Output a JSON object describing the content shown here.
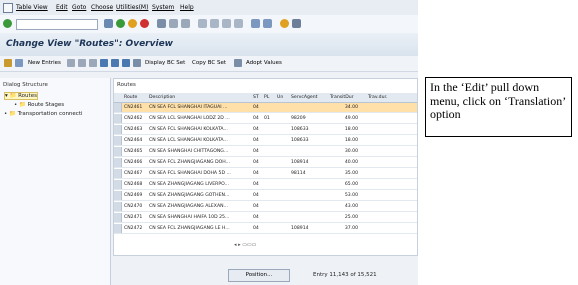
{
  "menu": [
    "Table View",
    "Edit",
    "Goto",
    "Choose",
    "Utilities(M)",
    "System",
    "Help"
  ],
  "title": "Change View \"Routes\": Overview",
  "app_toolbar": {
    "new_entries": "New Entries",
    "display_bc_set": "Display BC Set",
    "copy_bc_set": "Copy BC Set",
    "adopt_values": "Adopt Values"
  },
  "left_pane": {
    "header": "Dialog Structure",
    "items": [
      "Routes",
      "Route Stages",
      "Transportation connecti"
    ]
  },
  "grid": {
    "title": "Routes",
    "columns": [
      "Route",
      "Description",
      "ST",
      "PL",
      "Un",
      "ServcAgent",
      "TransitDur",
      "Trav.dur."
    ],
    "rows": [
      {
        "route": "CN2461",
        "desc": "CN SEA FCL SHANGHAI ITAGUAI ...",
        "st": "04",
        "pl": "",
        "un": "",
        "agent": "",
        "transit": "34.00",
        "trav": "",
        "hl": true
      },
      {
        "route": "CN2462",
        "desc": "CN SEA LCL SHANGHAI LODZ 2D ...",
        "st": "04",
        "pl": "01",
        "un": "",
        "agent": "98209",
        "transit": "49.00",
        "trav": "",
        "hl": false
      },
      {
        "route": "CN2463",
        "desc": "CN SEA FCL SHANGHAI KOLKATA...",
        "st": "04",
        "pl": "",
        "un": "",
        "agent": "108633",
        "transit": "18.00",
        "trav": "",
        "hl": false
      },
      {
        "route": "CN2464",
        "desc": "CN SEA LCL SHANGHAI KOLKATA...",
        "st": "04",
        "pl": "",
        "un": "",
        "agent": "108633",
        "transit": "18.00",
        "trav": "",
        "hl": false
      },
      {
        "route": "CN2465",
        "desc": "CN SEA SHANGHAI CHITTAGONG...",
        "st": "04",
        "pl": "",
        "un": "",
        "agent": "",
        "transit": "30.00",
        "trav": "",
        "hl": false
      },
      {
        "route": "CN2466",
        "desc": "CN SEA FCL ZHANGJIAGANG DOH...",
        "st": "04",
        "pl": "",
        "un": "",
        "agent": "108914",
        "transit": "40.00",
        "trav": "",
        "hl": false
      },
      {
        "route": "CN2467",
        "desc": "CN SEA FCL SHANGHAI DOHA 5D ...",
        "st": "04",
        "pl": "",
        "un": "",
        "agent": "98114",
        "transit": "35.00",
        "trav": "",
        "hl": false
      },
      {
        "route": "CN2468",
        "desc": "CN SEA ZHANGJIAGANG LIVERPO...",
        "st": "04",
        "pl": "",
        "un": "",
        "agent": "",
        "transit": "65.00",
        "trav": "",
        "hl": false
      },
      {
        "route": "CN2469",
        "desc": "CN SEA ZHANGJIAGANG GOTHEN...",
        "st": "04",
        "pl": "",
        "un": "",
        "agent": "",
        "transit": "53.00",
        "trav": "",
        "hl": false
      },
      {
        "route": "CN2470",
        "desc": "CN SEA ZHANGJIAGANG ALEXAN...",
        "st": "04",
        "pl": "",
        "un": "",
        "agent": "",
        "transit": "43.00",
        "trav": "",
        "hl": false
      },
      {
        "route": "CN2471",
        "desc": "CN SEA SHANGHAI HAIFA 10D 25...",
        "st": "04",
        "pl": "",
        "un": "",
        "agent": "",
        "transit": "25.00",
        "trav": "",
        "hl": false
      },
      {
        "route": "CN2472",
        "desc": "CN SEA FCL ZHANGJIAGANG LE H...",
        "st": "04",
        "pl": "",
        "un": "",
        "agent": "108914",
        "transit": "37.00",
        "trav": "",
        "hl": false
      }
    ]
  },
  "position_button": "Position...",
  "entry_text": "Entry 11,143 of 15,521",
  "annotation": "In the ‘Edit’ pull down menu, click on ‘Translation’ option",
  "colors": {
    "highlight_row": "#ffe0a8",
    "title_text": "#1d3557",
    "accent": "#d8c060"
  }
}
